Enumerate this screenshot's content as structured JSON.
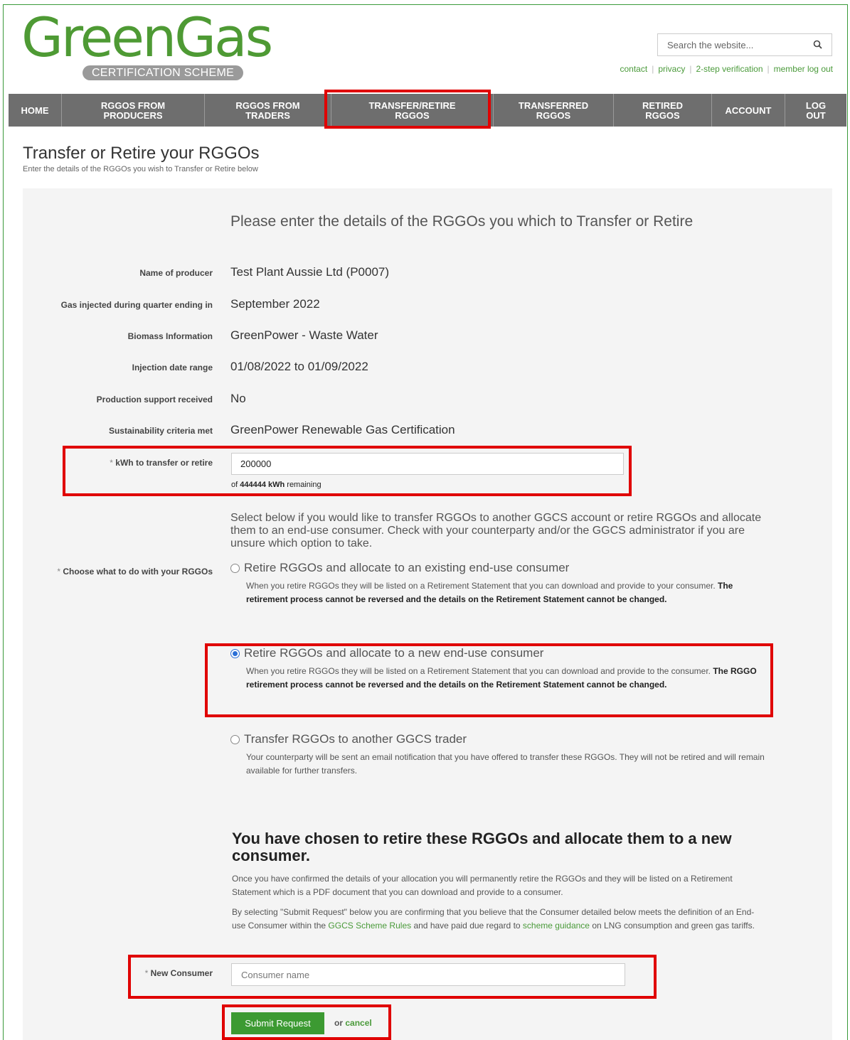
{
  "brand": {
    "name": "GreenGas",
    "subtitle": "CERTIFICATION SCHEME",
    "green": "#4e9a34"
  },
  "search": {
    "placeholder": "Search the website..."
  },
  "toplinks": [
    "contact",
    "privacy",
    "2-step verification",
    "member log out"
  ],
  "nav": [
    {
      "label": "HOME"
    },
    {
      "label": "RGGOS FROM\nPRODUCERS"
    },
    {
      "label": "RGGOS FROM\nTRADERS"
    },
    {
      "label": "TRANSFER/RETIRE\nRGGOS"
    },
    {
      "label": "TRANSFERRED\nRGGOS"
    },
    {
      "label": "RETIRED\nRGGOS"
    },
    {
      "label": "ACCOUNT"
    },
    {
      "label": "LOG\nOUT"
    }
  ],
  "page": {
    "title": "Transfer or Retire your RGGOs",
    "subtitle": "Enter the details of the RGGOs you wish to Transfer or Retire below"
  },
  "form": {
    "intro": "Please enter the details of the RGGOs you which to Transfer or Retire",
    "fields": [
      {
        "label": "Name of producer",
        "value": "Test Plant Aussie Ltd (P0007)"
      },
      {
        "label": "Gas injected during quarter ending in",
        "value": "September 2022"
      },
      {
        "label": "Biomass Information",
        "value": "GreenPower - Waste Water"
      },
      {
        "label": "Injection date range",
        "value": "01/08/2022 to 01/09/2022"
      },
      {
        "label": "Production support received",
        "value": "No"
      },
      {
        "label": "Sustainability criteria met",
        "value": "GreenPower Renewable Gas Certification"
      }
    ],
    "kwh": {
      "required_mark": "* ",
      "label": "kWh to transfer or retire",
      "value": "200000",
      "remaining_prefix": "of ",
      "remaining_amount": "444444 kWh",
      "remaining_suffix": " remaining"
    },
    "select_text": "Select below if you would like to transfer RGGOs to another GGCS account or retire RGGOs and allocate them to an end-use consumer. Check with your counterparty and/or the GGCS administrator if you are unsure which option to take.",
    "choose": {
      "required_mark": "* ",
      "label": "Choose what to do with your RGGOs"
    },
    "options": [
      {
        "title": "Retire RGGOs and allocate to an existing end-use consumer",
        "desc": "When you retire RGGOs they will be listed on a Retirement Statement that you can download and provide to your consumer. ",
        "desc_bold": "The retirement process cannot be reversed and the details on the Retirement Statement cannot be changed.",
        "selected": false
      },
      {
        "title": "Retire RGGOs and allocate to a new end-use consumer",
        "desc": "When you retire RGGOs they will be listed on a Retirement Statement that you can download and provide to the consumer. ",
        "desc_bold": "The RGGO retirement process cannot be reversed and the details on the Retirement Statement cannot be changed.",
        "selected": true
      },
      {
        "title": "Transfer RGGOs to another GGCS trader",
        "desc": "Your counterparty will be sent an email notification that you have offered to transfer these RGGOs. They will not be retired and will remain available for further transfers.",
        "desc_bold": "",
        "selected": false
      }
    ],
    "chosen_heading": "You have chosen to retire these RGGOs and allocate them to a new consumer.",
    "para1": "Once you have confirmed the details of your allocation you will permanently retire the RGGOs and they will be listed on a Retirement Statement which is a PDF document that you can download and provide to a consumer.",
    "para2_a": "By selecting \"Submit Request\" below you are confirming that you believe that the Consumer detailed below meets the definition of an End-use Consumer within the ",
    "para2_link1": "GGCS Scheme Rules",
    "para2_b": " and have paid due regard to ",
    "para2_link2": "scheme guidance",
    "para2_c": " on LNG consumption and green gas tariffs.",
    "consumer": {
      "required_mark": "* ",
      "label": "New Consumer",
      "placeholder": "Consumer name"
    },
    "submit_label": "Submit Request",
    "or_text": "or ",
    "cancel_label": "cancel"
  }
}
